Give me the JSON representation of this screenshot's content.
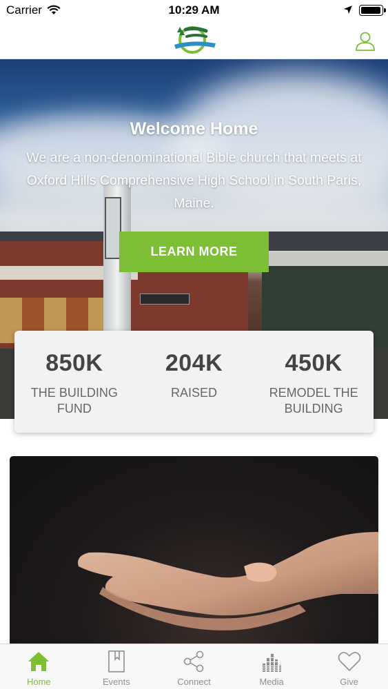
{
  "status_bar": {
    "carrier": "Carrier",
    "time": "10:29 AM"
  },
  "header": {
    "logo_alt": "Moss Brook Community Church",
    "brand_color": "#7cbf35"
  },
  "hero": {
    "title": "Welcome Home",
    "text": "We are a non-denominational Bible church that meets at Oxford Hills Comprehensive High School in South Paris, Maine.",
    "button_label": "LEARN MORE"
  },
  "stats": [
    {
      "value": "850K",
      "label": "THE BUILDING FUND"
    },
    {
      "value": "204K",
      "label": "RAISED"
    },
    {
      "value": "450K",
      "label": "REMODEL THE BUILDING"
    }
  ],
  "tab_bar": {
    "active_color": "#7cbf35",
    "inactive_color": "#8e8e8e",
    "tabs": [
      {
        "label": "Home",
        "icon": "home-icon",
        "active": true
      },
      {
        "label": "Events",
        "icon": "events-icon",
        "active": false
      },
      {
        "label": "Connect",
        "icon": "share-icon",
        "active": false
      },
      {
        "label": "Media",
        "icon": "media-icon",
        "active": false
      },
      {
        "label": "Give",
        "icon": "heart-icon",
        "active": false
      }
    ]
  }
}
